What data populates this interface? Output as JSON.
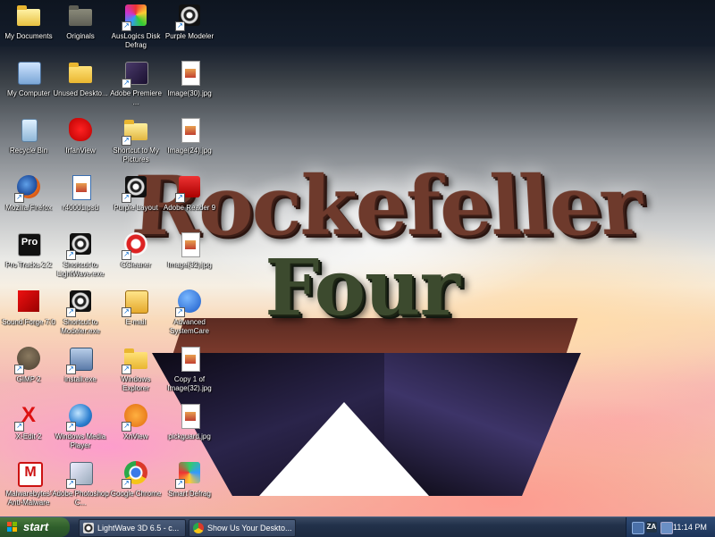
{
  "wallpaper": {
    "line1": "Rockefeller",
    "line2": "Four"
  },
  "desktop_icons": [
    {
      "label": "My Documents",
      "icon": "my-documents-icon"
    },
    {
      "label": "Originals",
      "icon": "folder-icon"
    },
    {
      "label": "AusLogics Disk Defrag",
      "icon": "auslogics-disk-defrag-icon"
    },
    {
      "label": "Purple Modeler",
      "icon": "lightwave-icon"
    },
    {
      "label": "My Computer",
      "icon": "my-computer-icon"
    },
    {
      "label": "Unused Deskto...",
      "icon": "folder-icon"
    },
    {
      "label": "Adobe Premiere ...",
      "icon": "adobe-premiere-icon"
    },
    {
      "label": "Image(30).jpg",
      "icon": "jpg-file-icon"
    },
    {
      "label": "Recycle Bin",
      "icon": "recycle-bin-icon"
    },
    {
      "label": "IrfanView",
      "icon": "irfanview-icon"
    },
    {
      "label": "Shortcut to My Pictures",
      "icon": "my-pictures-icon"
    },
    {
      "label": "Image(24).jpg",
      "icon": "jpg-file-icon"
    },
    {
      "label": "Mozilla Firefox",
      "icon": "firefox-icon"
    },
    {
      "label": "r40001.psd",
      "icon": "psd-file-icon"
    },
    {
      "label": "Purple Layout",
      "icon": "lightwave-icon"
    },
    {
      "label": "Adobe Reader 9",
      "icon": "adobe-reader-icon"
    },
    {
      "label": "Pro Tracks 2.2",
      "icon": "pro-tracks-icon"
    },
    {
      "label": "Shortcut to LightWave.exe",
      "icon": "lightwave-icon"
    },
    {
      "label": "CCleaner",
      "icon": "ccleaner-icon"
    },
    {
      "label": "Image(32).jpg",
      "icon": "jpg-file-icon"
    },
    {
      "label": "Sound Forge 7.0",
      "icon": "sound-forge-icon"
    },
    {
      "label": "Shortcut to Modeler.exe",
      "icon": "lightwave-icon"
    },
    {
      "label": "E-mail",
      "icon": "email-icon"
    },
    {
      "label": "Advanced SystemCare",
      "icon": "advanced-systemcare-icon"
    },
    {
      "label": "GIMP 2",
      "icon": "gimp-icon"
    },
    {
      "label": "install.exe",
      "icon": "installer-icon"
    },
    {
      "label": "Windows Explorer",
      "icon": "windows-explorer-icon"
    },
    {
      "label": "Copy 1 of Image(32).jpg",
      "icon": "jpg-file-icon"
    },
    {
      "label": "X-Edit 2",
      "icon": "x-edit-icon"
    },
    {
      "label": "Windows Media Player",
      "icon": "windows-media-player-icon"
    },
    {
      "label": "XnView",
      "icon": "xnview-icon"
    },
    {
      "label": "pickguard.jpg",
      "icon": "jpg-file-icon"
    },
    {
      "label": "Malwarebytes' Anti-Malware",
      "icon": "malwarebytes-icon"
    },
    {
      "label": "Adobe Photoshop C...",
      "icon": "photoshop-icon"
    },
    {
      "label": "Google Chrome",
      "icon": "chrome-icon"
    },
    {
      "label": "Smart Defrag",
      "icon": "smart-defrag-icon"
    }
  ],
  "taskbar": {
    "start_label": "start",
    "tasks": [
      {
        "label": "LightWave 3D 6.5 - c...",
        "icon": "lightwave-icon"
      },
      {
        "label": "Show Us Your Deskto...",
        "icon": "chrome-icon"
      }
    ],
    "tray": {
      "icons": [
        "network-icon",
        "za-icon",
        "speaker-icon"
      ],
      "za_label": "ZA",
      "clock": "11:14 PM"
    }
  },
  "colors": {
    "taskbar": "#22314a",
    "start_button": "#2f5f2b",
    "tray": "#1c3358",
    "label_text": "#ffffff"
  }
}
